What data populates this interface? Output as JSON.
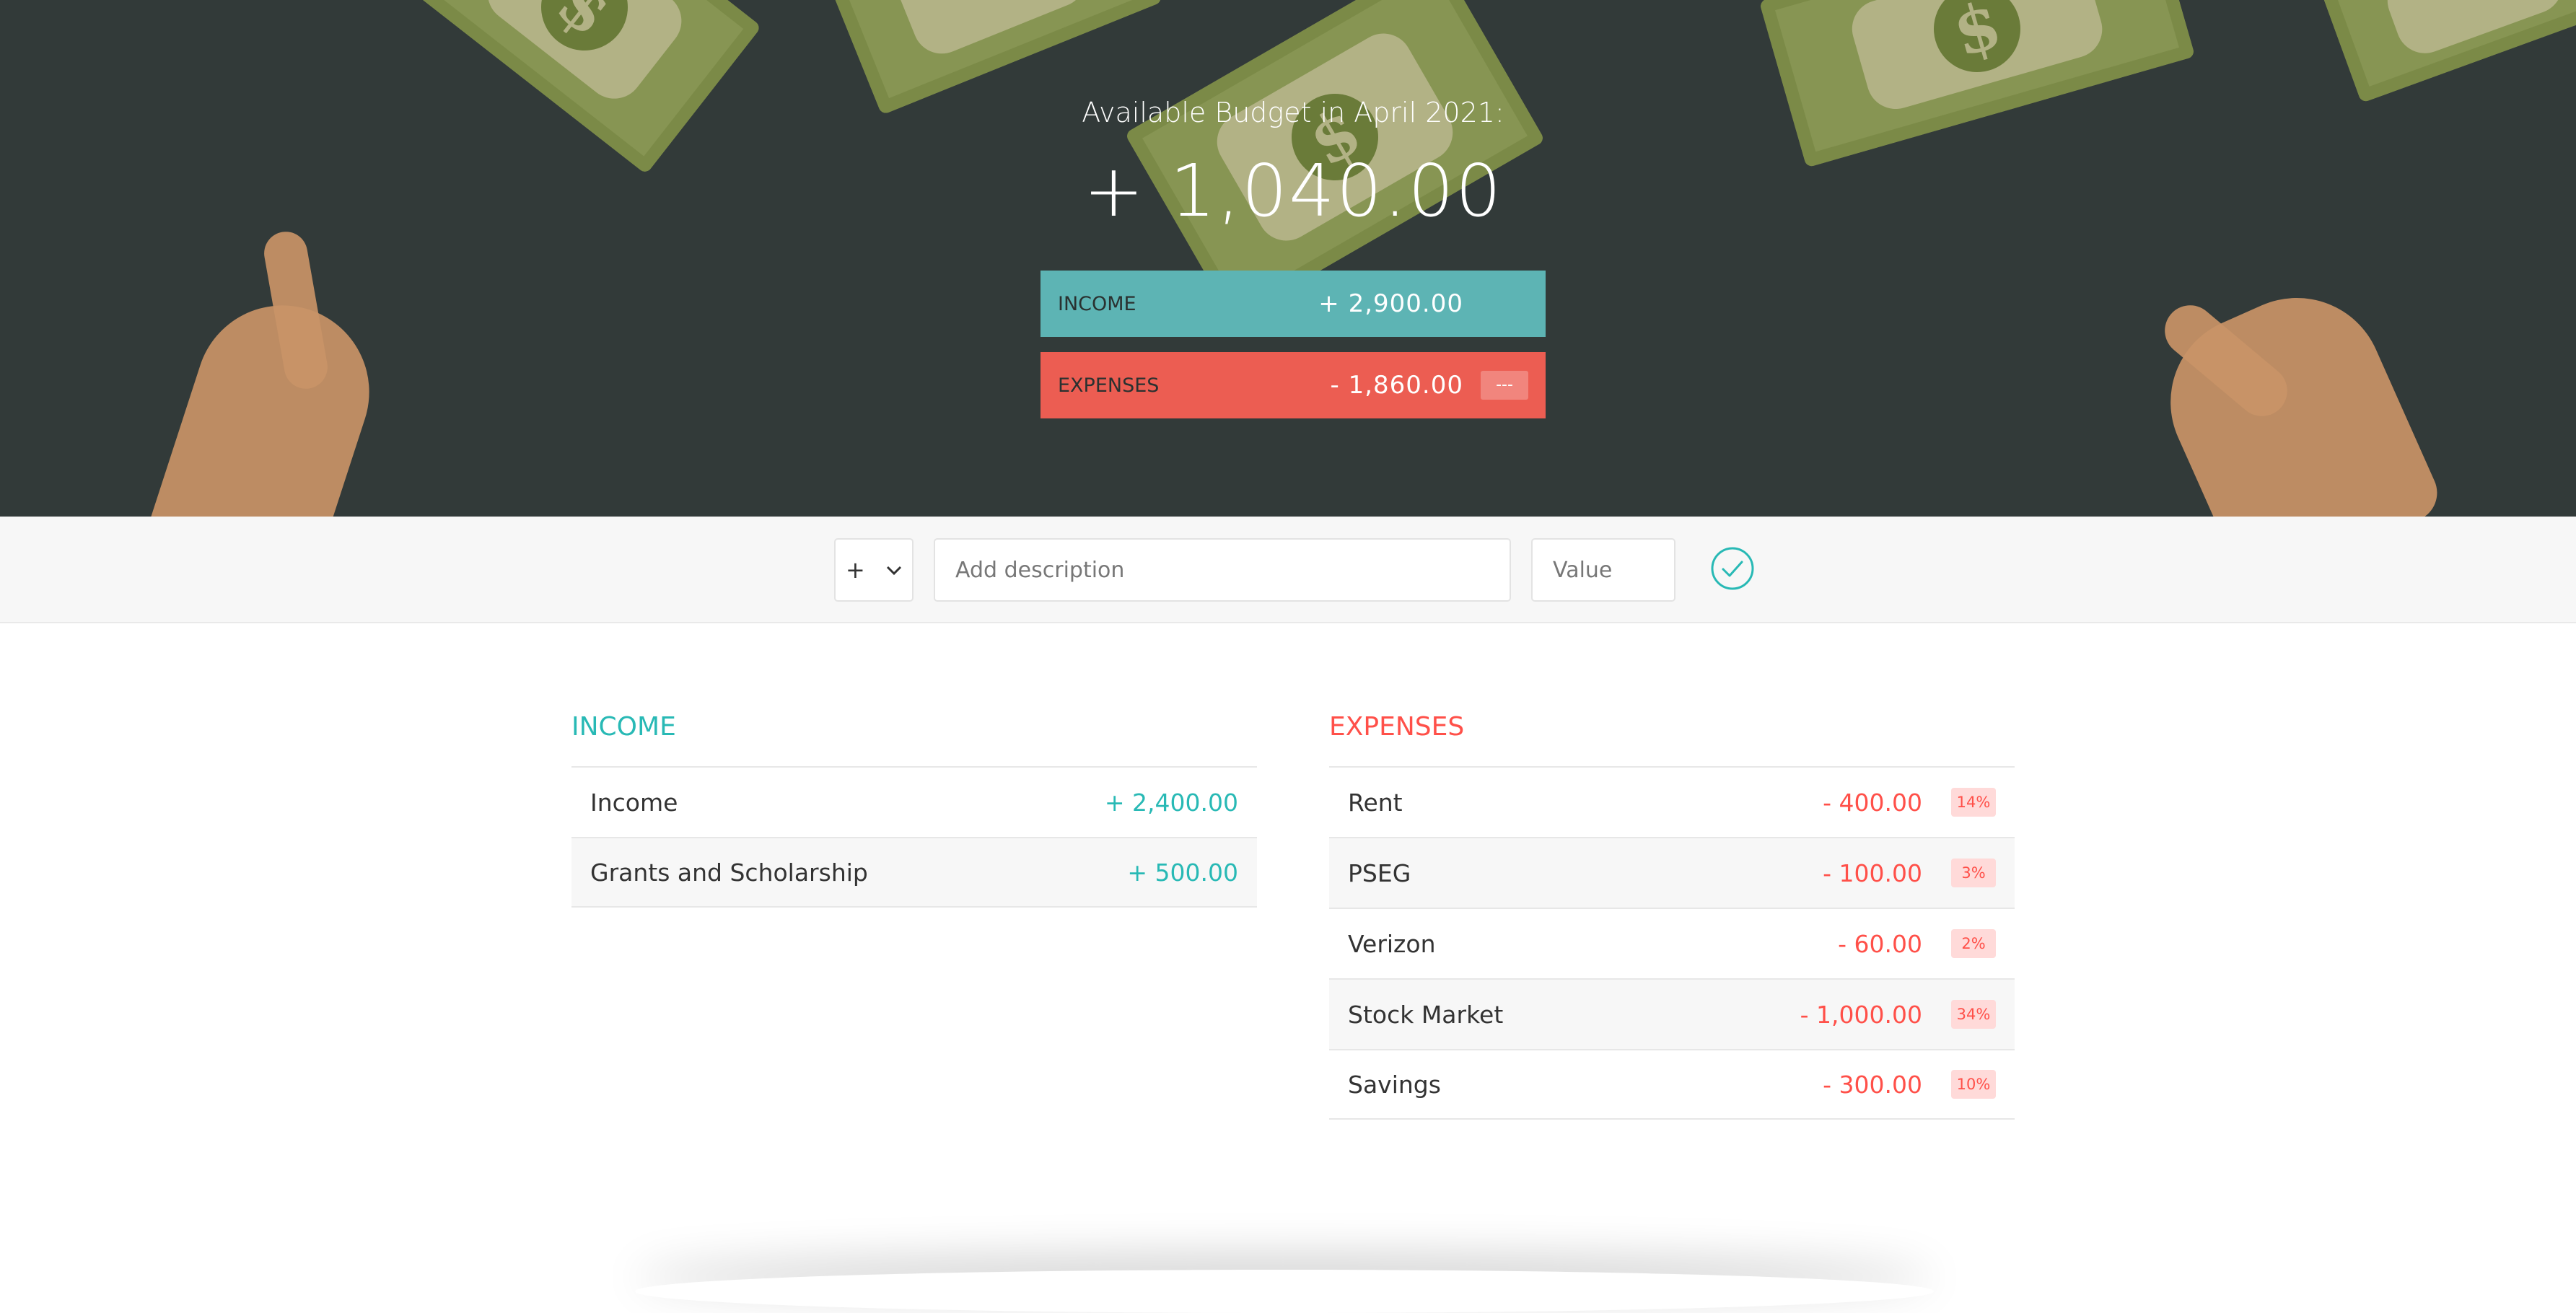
{
  "header": {
    "title": "Available Budget in April 2021:",
    "budget": "+ 1,040.00",
    "income_label": "Income",
    "income_value": "+ 2,900.00",
    "expenses_label": "Expenses",
    "expenses_value": "- 1,860.00",
    "expenses_percentage": "---"
  },
  "add_form": {
    "type_value": "+",
    "description_placeholder": "Add description",
    "value_placeholder": "Value"
  },
  "income": {
    "title": "Income",
    "items": [
      {
        "description": "Income",
        "value": "+ 2,400.00"
      },
      {
        "description": "Grants and Scholarship",
        "value": "+ 500.00"
      }
    ]
  },
  "expenses": {
    "title": "Expenses",
    "items": [
      {
        "description": "Rent",
        "value": "- 400.00",
        "percentage": "14%"
      },
      {
        "description": "PSEG",
        "value": "- 100.00",
        "percentage": "3%"
      },
      {
        "description": "Verizon",
        "value": "- 60.00",
        "percentage": "2%"
      },
      {
        "description": "Stock Market",
        "value": "- 1,000.00",
        "percentage": "34%"
      },
      {
        "description": "Savings",
        "value": "- 300.00",
        "percentage": "10%"
      }
    ]
  },
  "colors": {
    "income_accent": "#28b9b5",
    "expenses_accent": "#ff5049",
    "income_bar": "#5db4b4",
    "expenses_bar": "#ec5d52",
    "hero_background": "#323a39"
  },
  "icons": {
    "add_button": "check-circle-icon",
    "type_dropdown": "chevron-down-icon"
  }
}
